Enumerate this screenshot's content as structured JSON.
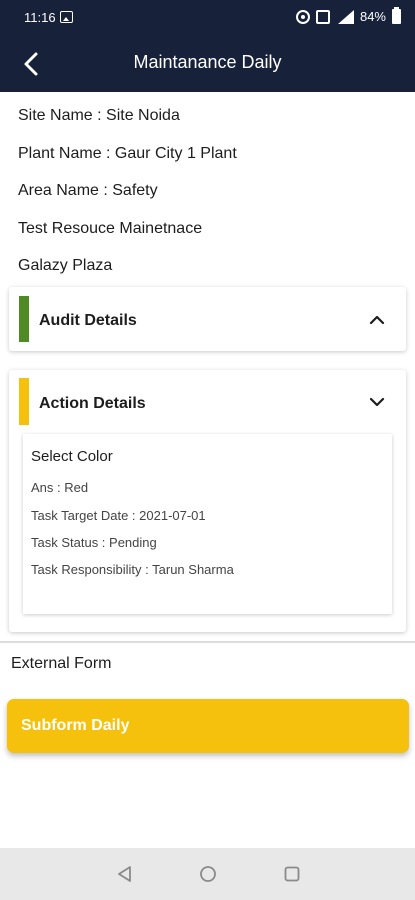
{
  "status_bar": {
    "time": "11:16",
    "battery": "84%"
  },
  "header": {
    "title": "Maintanance Daily"
  },
  "info": {
    "site": "Site Name : Site Noida",
    "plant": "Plant Name : Gaur City 1 Plant",
    "area": "Area Name : Safety",
    "resource": "Test Resouce Mainetnace",
    "location": "Galazy Plaza"
  },
  "audit": {
    "title": "Audit Details",
    "accent": "#4f8a24",
    "state": "expanded"
  },
  "action": {
    "title": "Action Details",
    "accent": "#f5c10d",
    "state": "collapsed",
    "heading": "Select Color",
    "ans": "Ans : Red",
    "target_date": "Task Target Date : 2021-07-01",
    "status": "Task Status : Pending",
    "responsibility": "Task Responsibility : Tarun Sharma"
  },
  "external_form": "External Form",
  "subform": {
    "label": "Subform Daily",
    "color": "#f5c10d"
  },
  "icons": [
    "back-arrow-icon",
    "chevron-up-icon",
    "chevron-down-icon",
    "nav-back-icon",
    "nav-home-icon",
    "nav-recents-icon"
  ],
  "colors": {
    "header_bg": "#17213a"
  }
}
